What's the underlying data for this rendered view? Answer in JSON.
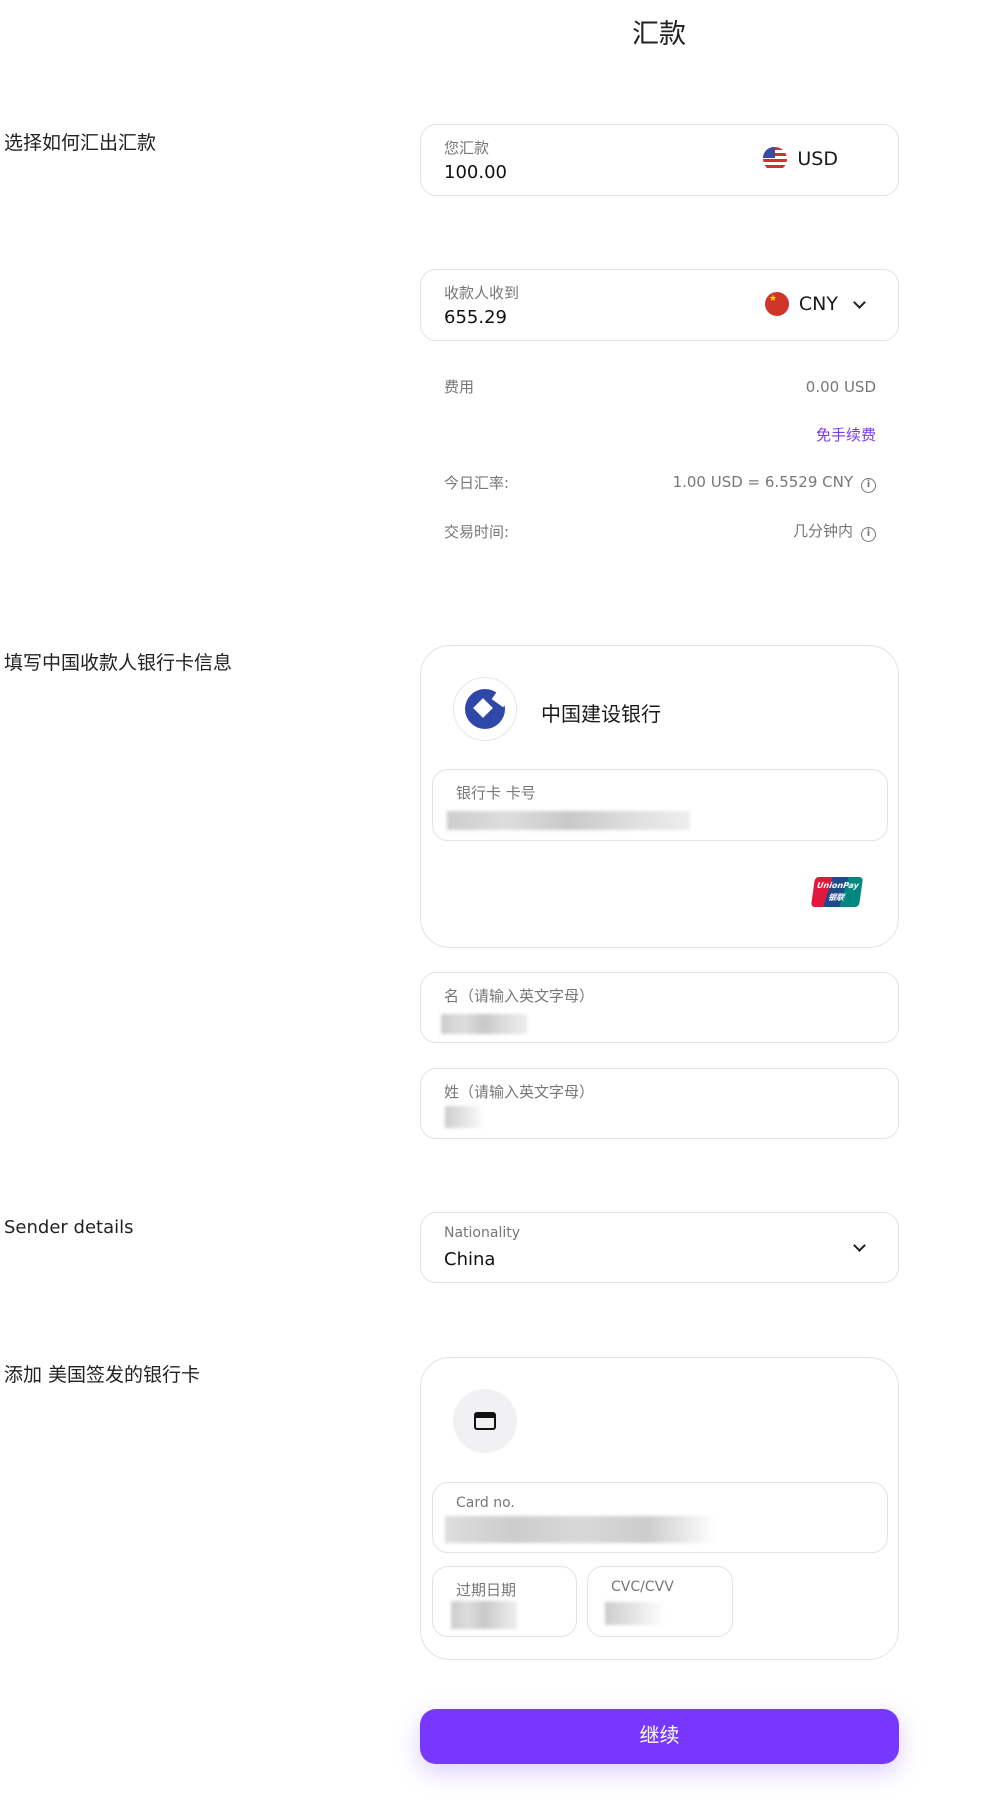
{
  "title": "汇款",
  "sections": {
    "send": "选择如何汇出汇款",
    "bank": "填写中国收款人银行卡信息",
    "sender": "Sender details",
    "card": "添加 美国签发的银行卡"
  },
  "send_amount": {
    "label": "您汇款",
    "value": "100.00",
    "currency": "USD"
  },
  "receive_amount": {
    "label": "收款人收到",
    "value": "655.29",
    "currency": "CNY"
  },
  "details": {
    "fee_label": "费用",
    "fee_value": "0.00 USD",
    "fee_note": "免手续费",
    "rate_label": "今日汇率:",
    "rate_value": "1.00 USD = 6.5529 CNY",
    "time_label": "交易时间:",
    "time_value": "几分钟内"
  },
  "bank": {
    "name": "中国建设银行",
    "card_label": "银行卡 卡号",
    "brand": "UnionPay 银联"
  },
  "first_name": {
    "label": "名（请输入英文字母）"
  },
  "last_name": {
    "label": "姓（请输入英文字母）"
  },
  "nationality": {
    "label": "Nationality",
    "value": "China"
  },
  "card": {
    "number_label": "Card no.",
    "expiry_label": "过期日期",
    "cvc_label": "CVC/CVV"
  },
  "continue": "继续",
  "colors": {
    "accent": "#7837ff"
  }
}
